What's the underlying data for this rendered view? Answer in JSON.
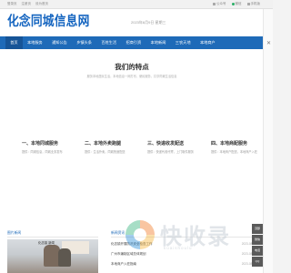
{
  "topbar": {
    "left_links": [
      "登录页",
      "注册页",
      "设为首页"
    ],
    "right_links": [
      "公众号",
      "微信",
      "手机版"
    ]
  },
  "header": {
    "logo": "化念同城信息网",
    "date": "2023年8月9日 星期三"
  },
  "nav": {
    "items": [
      "首页",
      "本地服务",
      "通知公告",
      "乡镇头条",
      "百姓生活",
      "招商引资",
      "本地新闻",
      "三农天地",
      "本地商户"
    ],
    "active_index": 0
  },
  "features": {
    "title": "我们的特点",
    "subtitle": "服务本地居民生活，本地信息一网打尽，便民服务，共享同城生活信息",
    "items": [
      {
        "title": "一、本地同城服务",
        "desc": "提供：同城信息，同城业务发布"
      },
      {
        "title": "二、本地外卖跑腿",
        "desc": "提供：生活外卖，同城快速配送"
      },
      {
        "title": "三、快递收发配送",
        "desc": "提供：快递代收代寄，上门取件服务"
      },
      {
        "title": "四、本地商配服务",
        "desc": "提供：本地商户配送，本地商户入驻"
      }
    ]
  },
  "bottom": {
    "left_title": "图片新闻",
    "right_title": "新闻资讯",
    "photo_caption": "化念镇 新闻",
    "news": [
      {
        "title": "化念镇开展防汛安全检查工作",
        "date": "2023-08-07"
      },
      {
        "title": "广州市编制区域总体规划",
        "date": "2023-08-06"
      },
      {
        "title": "本地商户入驻指南",
        "date": "2023-08-05"
      }
    ]
  },
  "watermark": {
    "text": "快收录",
    "sub": "kuaishoulu"
  },
  "float_tools": [
    "顶部",
    "微信",
    "电话",
    "QQ"
  ],
  "colors": {
    "brand": "#1565c0",
    "nav_bg": "#1e6ab8",
    "nav_active": "#165497"
  }
}
